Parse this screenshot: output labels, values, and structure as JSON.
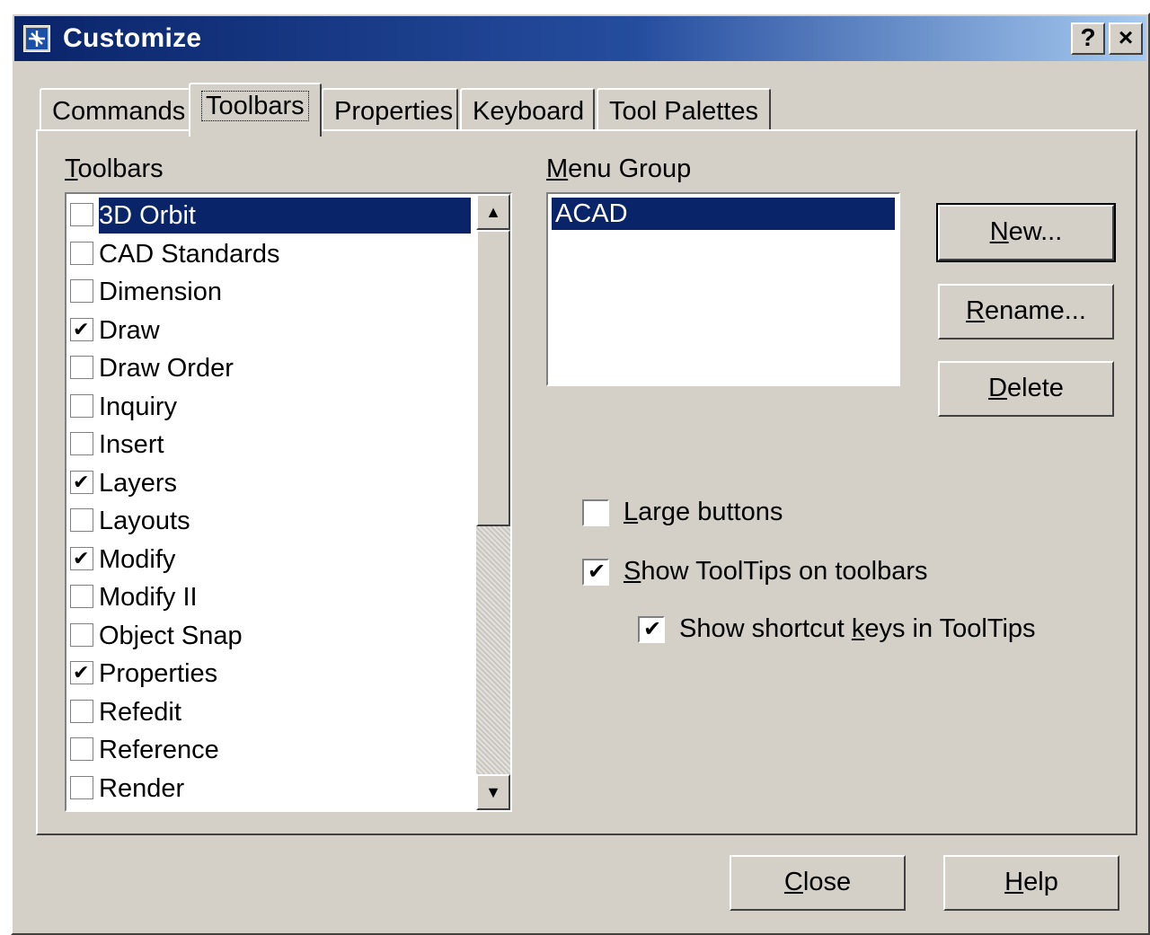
{
  "window": {
    "title": "Customize",
    "help_button": "?",
    "close_button": "×"
  },
  "tabs": [
    {
      "label": "Commands",
      "active": false
    },
    {
      "label": "Toolbars",
      "active": true
    },
    {
      "label": "Properties",
      "active": false
    },
    {
      "label": "Keyboard",
      "active": false
    },
    {
      "label": "Tool Palettes",
      "active": false
    }
  ],
  "toolbars_group": {
    "label_mnemonic": "T",
    "label_rest": "oolbars",
    "items": [
      {
        "label": "3D Orbit",
        "checked": false,
        "selected": true
      },
      {
        "label": "CAD Standards",
        "checked": false,
        "selected": false
      },
      {
        "label": "Dimension",
        "checked": false,
        "selected": false
      },
      {
        "label": "Draw",
        "checked": true,
        "selected": false
      },
      {
        "label": "Draw Order",
        "checked": false,
        "selected": false
      },
      {
        "label": "Inquiry",
        "checked": false,
        "selected": false
      },
      {
        "label": "Insert",
        "checked": false,
        "selected": false
      },
      {
        "label": "Layers",
        "checked": true,
        "selected": false
      },
      {
        "label": "Layouts",
        "checked": false,
        "selected": false
      },
      {
        "label": "Modify",
        "checked": true,
        "selected": false
      },
      {
        "label": "Modify II",
        "checked": false,
        "selected": false
      },
      {
        "label": "Object Snap",
        "checked": false,
        "selected": false
      },
      {
        "label": "Properties",
        "checked": true,
        "selected": false
      },
      {
        "label": "Refedit",
        "checked": false,
        "selected": false
      },
      {
        "label": "Reference",
        "checked": false,
        "selected": false
      },
      {
        "label": "Render",
        "checked": false,
        "selected": false
      }
    ],
    "scroll_up_glyph": "▲",
    "scroll_down_glyph": "▼"
  },
  "menu_group": {
    "label_mnemonic": "M",
    "label_rest": "enu Group",
    "items": [
      "ACAD"
    ]
  },
  "buttons": {
    "new": {
      "mnemonic": "N",
      "rest": "ew..."
    },
    "rename": {
      "mnemonic": "R",
      "rest": "ename..."
    },
    "delete": {
      "mnemonic": "D",
      "rest": "elete"
    },
    "close": {
      "mnemonic": "C",
      "rest": "lose"
    },
    "help": {
      "mnemonic": "H",
      "rest": "elp"
    }
  },
  "options": {
    "large_buttons": {
      "pre": "",
      "mnemonic": "L",
      "rest": "arge buttons",
      "checked": false
    },
    "show_tooltips": {
      "pre": "",
      "mnemonic": "S",
      "rest": "how ToolTips on toolbars",
      "checked": true
    },
    "show_shortcut_keys": {
      "pre": "Show shortcut ",
      "mnemonic": "k",
      "rest": "eys in ToolTips",
      "checked": true
    }
  },
  "check_glyph": "✔",
  "colors": {
    "title_start": "#0a246a",
    "title_end": "#a6caf0",
    "dialog_face": "#d4d0c8",
    "selection": "#0a246a"
  }
}
